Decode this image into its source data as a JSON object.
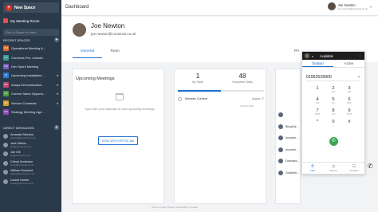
{
  "sidebar": {
    "new_space": "New Space",
    "meeting_room": "My Meeting Room",
    "find_placeholder": "Find a Space or User...",
    "recent_spaces_label": "RECENT SPACES",
    "direct_messages_label": "DIRECT MESSAGES",
    "spaces": [
      {
        "abbr": "OM",
        "label": "Operational Meeting &...",
        "color": "#e06d2c",
        "starred": false
      },
      {
        "abbr": "CF",
        "label": "Connexis Pre- consult...",
        "color": "#3a9b8f",
        "starred": false
      },
      {
        "abbr": "DS",
        "label": "Dev Sprint Meeting",
        "color": "#7b5cc0",
        "starred": false
      },
      {
        "abbr": "UI",
        "label": "Upcoming Installation...",
        "color": "#2f7bd6",
        "starred": true
      },
      {
        "abbr": "AD",
        "label": "Avaya Demonstration...",
        "color": "#c0496f",
        "starred": true
      },
      {
        "abbr": "CS",
        "label": "Current Sales Opportu...",
        "color": "#4a9b3f",
        "starred": true
      },
      {
        "abbr": "SC",
        "label": "Service Contracts",
        "color": "#d6a02f",
        "starred": true
      },
      {
        "abbr": "SM",
        "label": "Strategy Meeting Age...",
        "color": "#8a4ab0",
        "starred": false
      }
    ],
    "dms": [
      {
        "name": "Amanda Stevens",
        "email": "amanda@connexis.co.uk"
      },
      {
        "name": "Jack Wilson",
        "email": "jack@connexis.co.uk"
      },
      {
        "name": "Joe Hill",
        "email": "joe@connexis.co.uk"
      },
      {
        "name": "Cheryl Anderson",
        "email": "cheryl@connexis.co.uk"
      },
      {
        "name": "William Rowland",
        "email": "william@connexis.co.uk"
      },
      {
        "name": "Louise Hunter",
        "email": "louise@connexis.co.uk"
      }
    ]
  },
  "topbar": {
    "title": "Dashboard",
    "user_name": "Joe Newton",
    "user_email": "joe.newton@connexis.co.uk"
  },
  "profile": {
    "name": "Joe Newton",
    "email": "joe.newton@connexis.co.uk",
    "tabs": [
      "General",
      "Team"
    ],
    "right_label": "Pri"
  },
  "upcoming": {
    "title": "Upcoming Meetings",
    "sync_text": "Sync with your calendar to view upcoming meetings",
    "sync_button": "SYNC WITH OFFICE 365"
  },
  "tasks": {
    "my_tasks_value": "1",
    "my_tasks_label": "My Tasks",
    "completed_value": "48",
    "completed_label": "Completed Tasks",
    "progress_fraction": 0.5,
    "task_name": "Website Content",
    "task_date": "August 17",
    "task_status": "IN DOD NOW"
  },
  "contacts": [
    "",
    "BingCal...",
    "Incomin...",
    "Incomin...",
    "Doncast...",
    "Goldnell..."
  ],
  "footer": "Terms of Use | Privacy Information | Credits",
  "dialer": {
    "status": "Available",
    "tabs": [
      "Dialpad",
      "Active"
    ],
    "number": "01952528000",
    "keys": [
      {
        "d": "1",
        "s": ""
      },
      {
        "d": "2",
        "s": "ABC"
      },
      {
        "d": "3",
        "s": "DEF"
      },
      {
        "d": "4",
        "s": "GHI"
      },
      {
        "d": "5",
        "s": "JKL"
      },
      {
        "d": "6",
        "s": "MNO"
      },
      {
        "d": "7",
        "s": "PQRS"
      },
      {
        "d": "8",
        "s": "TUV"
      },
      {
        "d": "9",
        "s": "WXYZ"
      },
      {
        "d": "*",
        "s": ""
      },
      {
        "d": "0",
        "s": "+"
      },
      {
        "d": "#",
        "s": ""
      }
    ],
    "nav": [
      "Calls",
      "Recent",
      "Contacts"
    ]
  }
}
